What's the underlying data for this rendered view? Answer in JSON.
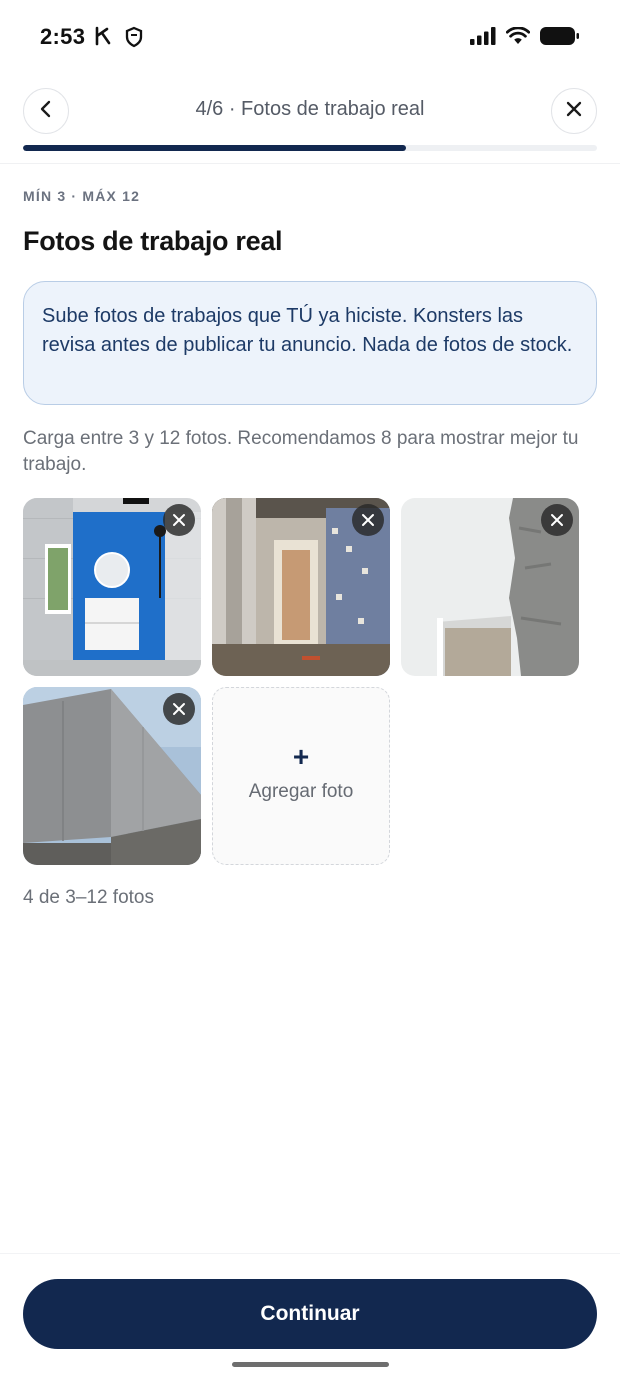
{
  "status_bar": {
    "time": "2:53",
    "icons": [
      "navigation-arrow-icon",
      "shield-icon",
      "cellular-signal-icon",
      "wifi-icon",
      "battery-icon"
    ]
  },
  "header": {
    "title": "4/6 · Fotos de trabajo real",
    "back_icon": "chevron-left-icon",
    "close_icon": "close-icon",
    "progress_fraction": 0.667
  },
  "main": {
    "eyebrow": "MÍN 3 · MÁX 12",
    "title": "Fotos de trabajo real",
    "info": "Sube fotos de trabajos que TÚ ya hiciste. Konsters las revisa antes de publicar tu anuncio. Nada de fotos de stock.",
    "helper": "Carga entre 3 y 12 fotos. Recomendamos 8 para mostrar mejor tu trabajo.",
    "photos": [
      {
        "subject": "bathroom-renovation-photo"
      },
      {
        "subject": "hallway-construction-photo"
      },
      {
        "subject": "plastered-wall-photo"
      },
      {
        "subject": "concrete-wall-photo"
      }
    ],
    "add_photo": {
      "icon": "plus-icon",
      "plus": "+",
      "label": "Agregar foto"
    },
    "count": "4 de 3–12 fotos"
  },
  "footer": {
    "continue_label": "Continuar"
  },
  "colors": {
    "primary": "#12284f",
    "info_bg": "#edf3fb",
    "info_border": "#b9cde6",
    "info_text": "#1d3a66"
  }
}
